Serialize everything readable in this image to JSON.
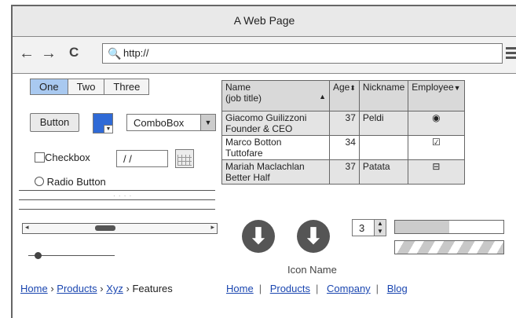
{
  "window": {
    "title": "A Web Page"
  },
  "browser": {
    "url": "http://",
    "back_icon": "←",
    "fwd_icon": "→",
    "reload_icon": "C",
    "search_icon": "🔍"
  },
  "tabs": [
    {
      "label": "One",
      "selected": true
    },
    {
      "label": "Two"
    },
    {
      "label": "Three"
    }
  ],
  "button": {
    "label": "Button"
  },
  "color_picker": {
    "color": "#2f6ad6"
  },
  "combobox": {
    "value": "ComboBox"
  },
  "checkbox": {
    "label": "Checkbox",
    "checked": false
  },
  "date_field": {
    "value": "/ /"
  },
  "radio": {
    "label": "Radio Button"
  },
  "table": {
    "headers": [
      "Name\n(job title)",
      "Age",
      "Nickname",
      "Employee"
    ],
    "rows": [
      {
        "name": "Giacomo Guilizzoni",
        "title": "Founder & CEO",
        "age": "37",
        "nickname": "Peldi",
        "employee": "◉"
      },
      {
        "name": "Marco Botton",
        "title": "Tuttofare",
        "age": "34",
        "nickname": "",
        "employee": "☑"
      },
      {
        "name": "Mariah Maclachlan",
        "title": "Better Half",
        "age": "37",
        "nickname": "Patata",
        "employee": "⊟"
      }
    ]
  },
  "numeric_stepper": {
    "value": "3"
  },
  "icon_label": "Icon Name",
  "progress": {
    "value": 0.5
  },
  "breadcrumb": {
    "items": [
      "Home",
      "Products",
      "Xyz"
    ],
    "current": "Features"
  },
  "links": [
    "Home",
    "Products",
    "Company",
    "Blog"
  ]
}
